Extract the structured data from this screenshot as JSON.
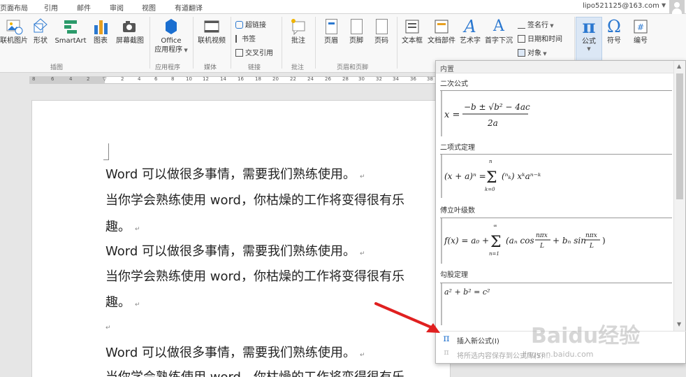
{
  "tabs": [
    "页面布局",
    "引用",
    "邮件",
    "审阅",
    "视图",
    "有道翻译"
  ],
  "account": "lipo521125@163.com",
  "ribbon": {
    "illustrations": {
      "online_pictures": "联机图片",
      "shapes": "形状",
      "smartart": "SmartArt",
      "chart": "图表",
      "screenshot": "屏幕截图",
      "group": "插图"
    },
    "apps": {
      "office_line1": "Office",
      "office_line2": "应用程序",
      "group": "应用程序"
    },
    "media": {
      "online_video": "联机视频",
      "group": "媒体"
    },
    "links": {
      "hyperlink": "超链接",
      "bookmark": "书签",
      "cross_reference": "交叉引用",
      "group": "链接"
    },
    "comments": {
      "comment": "批注",
      "group": "批注"
    },
    "header_footer": {
      "header": "页眉",
      "footer": "页脚",
      "page_number": "页码",
      "group": "页眉和页脚"
    },
    "text": {
      "text_box": "文本框",
      "quick_parts": "文档部件",
      "wordart": "艺术字",
      "drop_cap": "首字下沉",
      "signature_line": "签名行",
      "date_time": "日期和时间",
      "object": "对象"
    },
    "symbols": {
      "equation": "公式",
      "symbol": "符号",
      "number": "编号"
    }
  },
  "ruler_ticks": [
    "8",
    "6",
    "4",
    "2",
    "",
    "2",
    "4",
    "6",
    "8",
    "10",
    "12",
    "14",
    "16",
    "18",
    "20",
    "22",
    "24",
    "26",
    "28",
    "30",
    "32",
    "34",
    "36",
    "38"
  ],
  "document": {
    "lines": [
      "Word 可以做很多事情，需要我们熟练使用。",
      "当你学会熟练使用 word，你枯燥的工作将变得很有乐",
      "趣。",
      "Word 可以做很多事情，需要我们熟练使用。",
      "当你学会熟练使用 word，你枯燥的工作将变得很有乐",
      "趣。",
      "",
      "Word 可以做很多事情，需要我们熟练使用。",
      "当你学会熟练使用 word，你枯燥的工作将变得很有乐"
    ],
    "paragraph_mark": "↵"
  },
  "equation_gallery": {
    "header": "内置",
    "sections": [
      {
        "title": "二次公式",
        "formula": "x = (−b ± √(b² − 4ac)) / 2a"
      },
      {
        "title": "二项式定理",
        "formula": "(x + a)ⁿ = Σ (n k) xᵏ aⁿ⁻ᵏ"
      },
      {
        "title": "傅立叶级数",
        "formula": "f(x) = a₀ + Σ (aₙ cos(nπx/L) + bₙ sin(nπx/L))"
      },
      {
        "title": "勾股定理",
        "formula": "a² + b² = c²"
      }
    ],
    "menu": {
      "insert_new": "插入新公式(I)",
      "save_selection": "将所选内容保存到公式库(S)..."
    }
  },
  "watermark": {
    "brand": "Baidu经验",
    "url": "jingyan.baidu.com"
  },
  "colors": {
    "accent": "#2b78d0",
    "arrow": "#e02020"
  }
}
